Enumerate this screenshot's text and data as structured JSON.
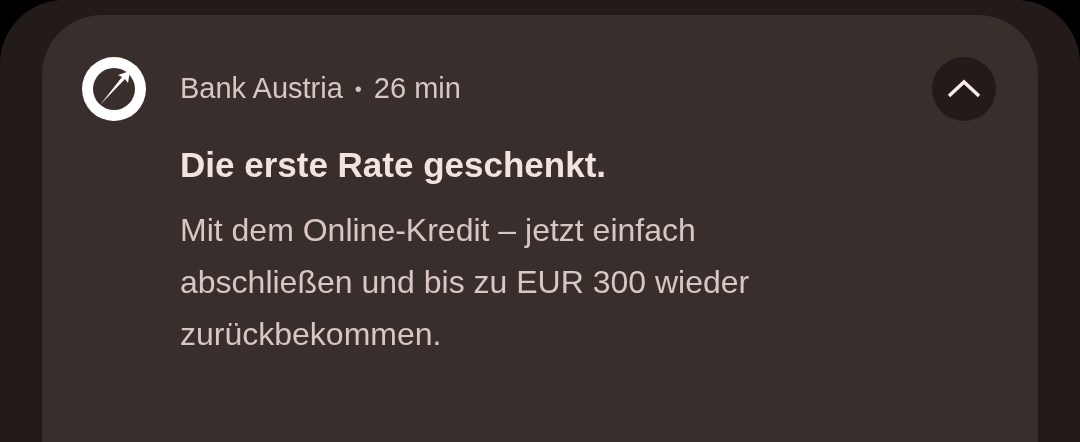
{
  "notification": {
    "app_name": "Bank Austria",
    "separator": "•",
    "time": "26 min",
    "expanded": true,
    "title": "Die erste Rate geschenkt.",
    "body": "Mit dem Online-Kredit – jetzt einfach abschließen und bis zu EUR 300 wieder zurückbekommen."
  }
}
